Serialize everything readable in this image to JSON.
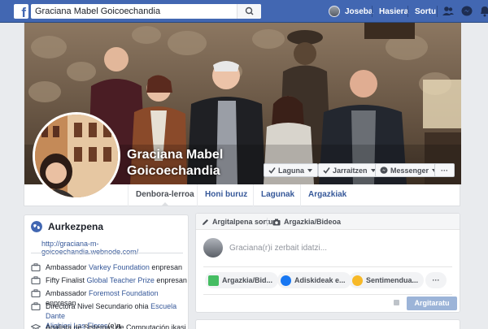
{
  "header": {
    "logo": "f",
    "search_value": "Graciana Mabel Goicoechandia",
    "user_name": "Joseba",
    "home_label": "Hasiera",
    "create_label": "Sortu",
    "icons": [
      "friends-icon",
      "messenger-icon",
      "notifications-icon"
    ]
  },
  "profile": {
    "name_line1": "Graciana Mabel",
    "name_line2": "Goicoechandia",
    "buttons": {
      "friend": "Laguna",
      "follow": "Jarraitzen",
      "messenger": "Messenger",
      "more": "···"
    },
    "tabs": [
      "Denbora-lerroa",
      "Honi buruz",
      "Lagunak",
      "Argazkiak"
    ]
  },
  "intro": {
    "title": "Aurkezpena",
    "website": "http://graciana-m-goicoechandia.webnode.com/",
    "items": [
      {
        "prefix": "Ambassador ",
        "link": "Varkey Foundation",
        "suffix": " enpresan"
      },
      {
        "prefix": "Fifty Finalist ",
        "link": "Global Teacher Prize",
        "suffix": " enpresan"
      },
      {
        "prefix": "Ambassador ",
        "link": "Foremost Foundation",
        "suffix": " enpresan"
      },
      {
        "prefix": "Directora Nivel Secundario ohia ",
        "link": "Escuela Dante",
        "line2_link": "Alighieri Las Flores",
        "line2_suffix": "(e)n"
      },
      {
        "prefix": "Analista de Sistemas de Computación ikasi",
        "link": "",
        "suffix": ""
      }
    ]
  },
  "composer": {
    "tab_post": "Argitalpena sortu",
    "tab_photo": "Argazkia/Bideoa",
    "placeholder": "Graciana(r)i zerbait idatzi...",
    "pills": [
      "Argazkia/Bid...",
      "Adiskideak e...",
      "Sentimendua..."
    ],
    "more": "···",
    "publish": "Argitaratu"
  },
  "colors": {
    "brand_blue": "#4267b2",
    "link_blue": "#365899",
    "background": "#e9ebee"
  }
}
